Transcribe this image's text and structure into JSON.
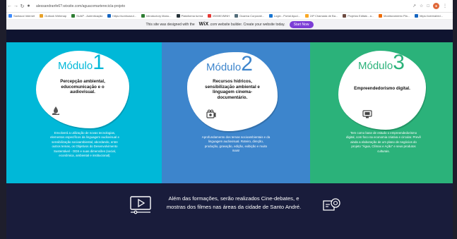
{
  "browser": {
    "url": "alessandranfe6?.wixsite.com/aguacomarterecicla-projeto",
    "bookmarks": [
      {
        "label": "Santacol Internet",
        "color": "#3d8bfd"
      },
      {
        "label": "Outlook Webmap",
        "color": "#e8a22a"
      },
      {
        "label": "SUAP - Autenticação",
        "color": "#2e7d32"
      },
      {
        "label": "https://sonhoazul...",
        "color": "#1565c0"
      },
      {
        "label": "Introductory Manu...",
        "color": "#2e7d32"
      },
      {
        "label": "Plataforma turma",
        "color": "#263238"
      },
      {
        "label": "MVMKVMNH",
        "color": "#e53935"
      },
      {
        "label": "Ocarina Corporati...",
        "color": "#546e7a"
      },
      {
        "label": "Login - Portal Ayud...",
        "color": "#1976d2"
      },
      {
        "label": "24ª Chamada de Ba...",
        "color": "#f9a825"
      },
      {
        "label": "Projetos Editais - a...",
        "color": "#6d4c41"
      },
      {
        "label": "Monitoramento Pla...",
        "color": "#ef6c00"
      },
      {
        "label": "https://central/ed...",
        "color": "#1565c0"
      }
    ]
  },
  "wix_banner": {
    "text_before": "This site was designed with the",
    "brand": "WiX",
    "text_after": ".com website builder. Create your website today.",
    "button": "Start Now"
  },
  "modules": [
    {
      "word": "Módulo",
      "number": "1",
      "title": "Percepção ambiental, educomunicação e o audiovisual.",
      "description": "Envolverá a utilização de novas tecnologias, elementos específicos da linguagem audiovisual e sensibilização socioambiental, abordando, entre outros temas, os Objetivos do Desenvolvimento Sustentável - ODS e suas dimensões (social, econômica, ambiental e institucional).",
      "icon": "water-drop-hand-icon"
    },
    {
      "word": "Módulo",
      "number": "2",
      "title": "Recursos hídricos, sensibilização ambiental e linguagem cinema-documentário.",
      "description": "Aprofundamento dos temas socioambientais e da linguagem audiovisual. Roteiro, direção, produção, gravação, edição, exibição e muito mais!",
      "icon": "film-camera-icon"
    },
    {
      "word": "Módulo",
      "number": "3",
      "title": "Empreendedorismo digital.",
      "description": "Tem como base de estudo o empreendedorismo digital, com foco na economia criativa e circular. Prevê ainda a elaboração de um plano de negócios do projeto \"Água, Clímax e Ação\" e seus produtos culturais.",
      "icon": "computer-monitor-icon"
    }
  ],
  "footer": {
    "text": "Além das formações, serão realizados Cine-debates, e mostras dos filmes nas áreas da cidade de Santo André."
  },
  "colors": {
    "module1": "#00b8d8",
    "module2": "#3d85cc",
    "module3": "#2bb27a",
    "footer": "#191c3b",
    "wix_button": "#7c3dd6"
  }
}
